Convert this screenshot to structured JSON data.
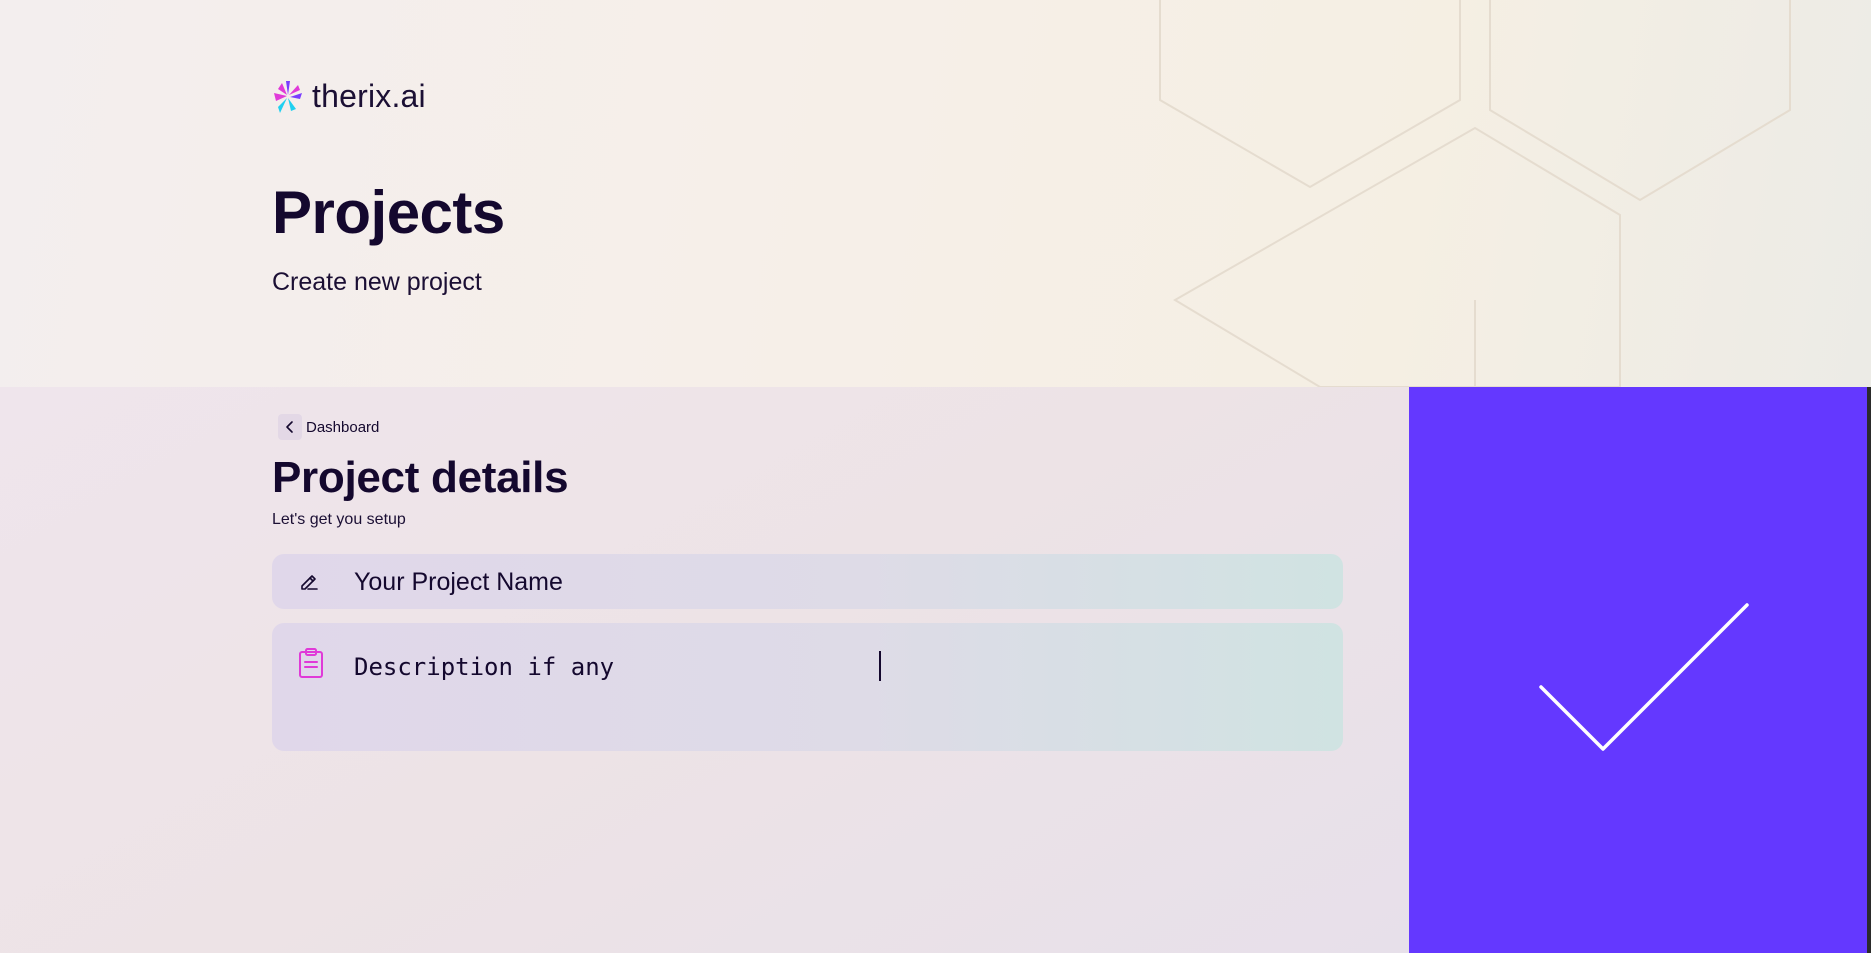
{
  "brand": {
    "name": "therix.ai",
    "colors": {
      "magenta": "#e03ad8",
      "cyan": "#1fd0f0",
      "violet": "#7a3cff",
      "accent": "#6438ff",
      "text": "#14082e"
    }
  },
  "header": {
    "title": "Projects",
    "subtitle": "Create new project"
  },
  "breadcrumb": {
    "back_label": "Dashboard",
    "back_icon": "chevron-left-icon"
  },
  "form": {
    "title": "Project details",
    "subtitle": "Let's get you setup",
    "name_field": {
      "placeholder": "Your Project Name",
      "icon": "pencil-icon"
    },
    "description_field": {
      "value": "Description if any",
      "icon": "clipboard-icon"
    }
  },
  "confirm": {
    "icon": "checkmark-icon",
    "color": "#6438ff"
  }
}
